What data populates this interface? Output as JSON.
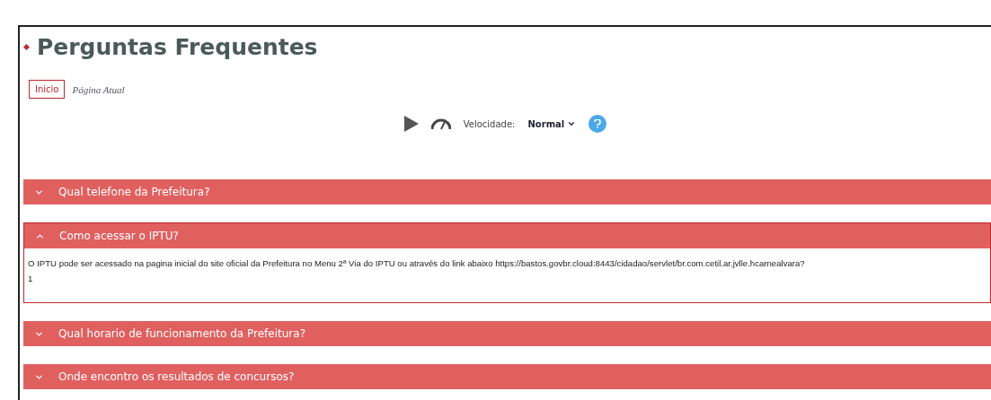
{
  "page": {
    "title": "Perguntas Frequentes"
  },
  "breadcrumb": [
    {
      "label": "Inicio",
      "kind": "button"
    },
    {
      "label": "Página Atual",
      "kind": "current"
    }
  ],
  "player": {
    "speed_label": "Velocidade:",
    "speed_value": "Normal"
  },
  "faqs": [
    {
      "question": "Qual telefone da Prefeitura?",
      "expanded": false
    },
    {
      "question": "Como acessar o IPTU?",
      "expanded": true,
      "answer": [
        "O IPTU pode ser acessado na pagina inicial do site oficial da Prefeitura no Menu 2ª Via do IPTU ou através do link abaixo https://bastos.govbr.cloud:8443/cidadao/servlet/br.com.cetil.ar.jvlle.hcarnealvara?",
        "1"
      ]
    },
    {
      "question": "Qual horario de funcionamento da Prefeitura?",
      "expanded": false
    },
    {
      "question": "Onde encontro os resultados de concursos?",
      "expanded": false
    }
  ]
}
